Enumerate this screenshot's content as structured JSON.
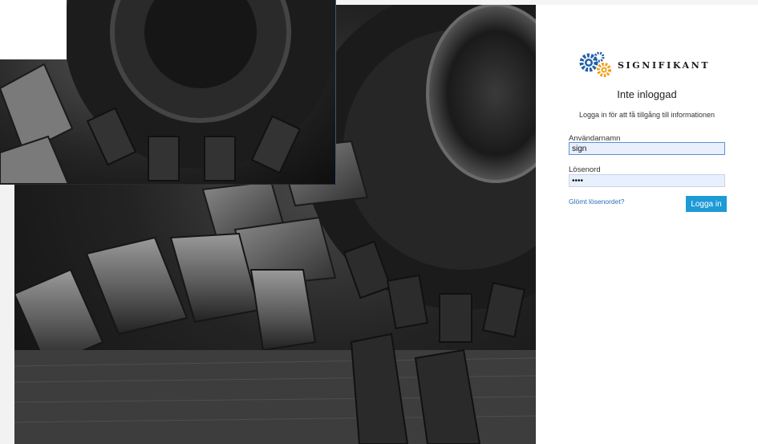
{
  "brand": {
    "name": "SIGNIFIKANT",
    "logo_icon": "gears-icon",
    "colors": {
      "gear_blue": "#1f5fa8",
      "gear_orange": "#f39c12"
    }
  },
  "login": {
    "title": "Inte inloggad",
    "subtitle": "Logga in för att få tillgång till informationen",
    "username_label": "Användarnamn",
    "username_value": "sign",
    "password_label": "Lösenord",
    "password_value": "••••",
    "forgot_link": "Glömt lösenordet?",
    "submit_label": "Logga in"
  },
  "colors": {
    "button_bg": "#1e9ad6",
    "link": "#2b6fb8",
    "input_bg": "#e8f0fe"
  }
}
